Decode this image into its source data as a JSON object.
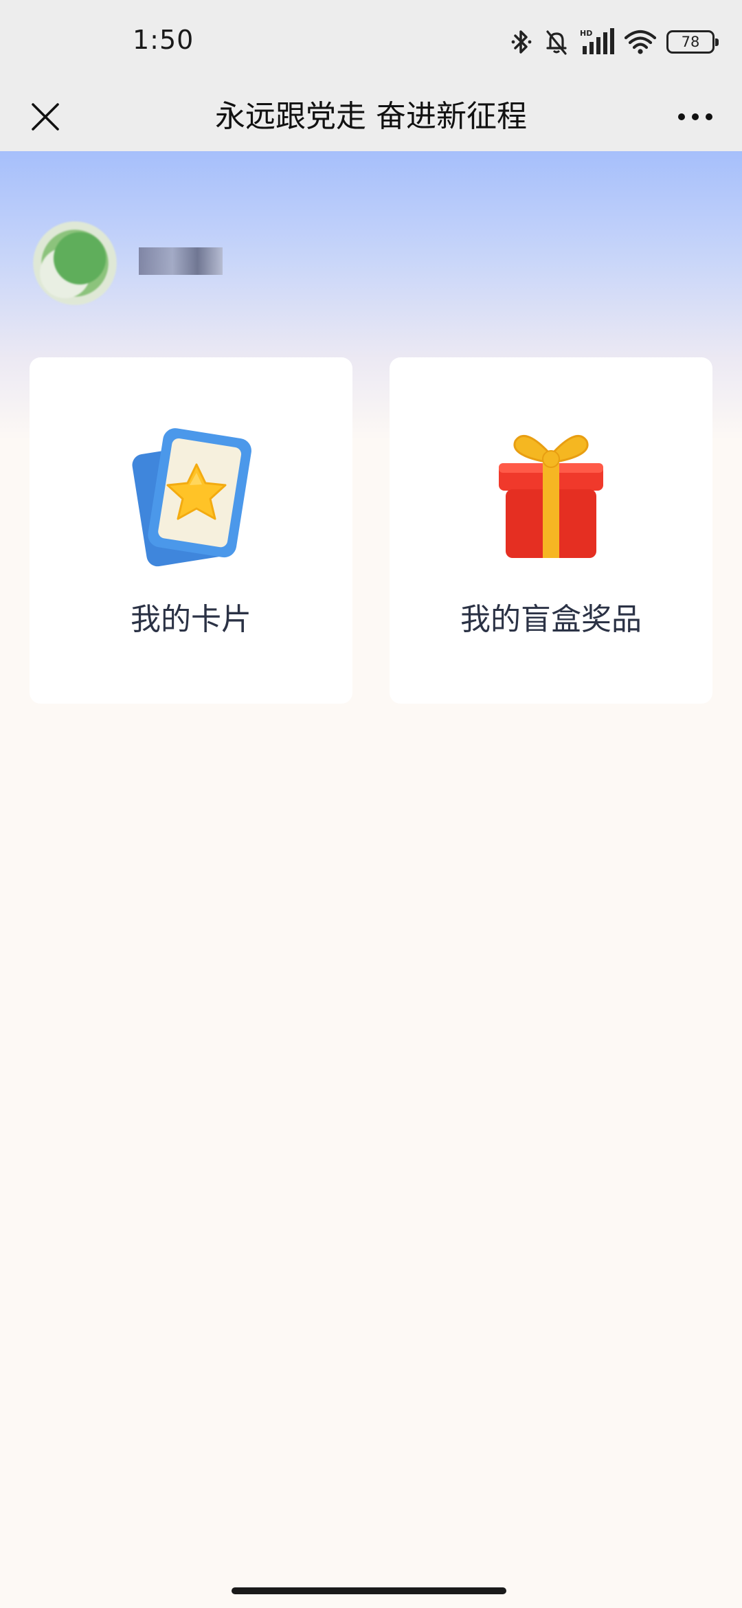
{
  "status_bar": {
    "time": "1:50",
    "battery": "78",
    "icons": [
      "bluetooth-icon",
      "bell-off-icon",
      "hd-signal-icon",
      "wifi-icon",
      "battery-icon"
    ]
  },
  "nav": {
    "title": "永远跟党走 奋进新征程",
    "close_icon": "close-icon",
    "more_icon": "more-dots-icon"
  },
  "profile": {
    "username": ""
  },
  "cards": [
    {
      "label": "我的卡片",
      "icon": "star-card-icon"
    },
    {
      "label": "我的盲盒奖品",
      "icon": "gift-box-icon"
    }
  ],
  "colors": {
    "header_bg": "#ededed",
    "hero_top": "#a6bffb",
    "page_bg": "#fdf9f5",
    "card_bg": "#ffffff",
    "label_text": "#2b3245"
  }
}
